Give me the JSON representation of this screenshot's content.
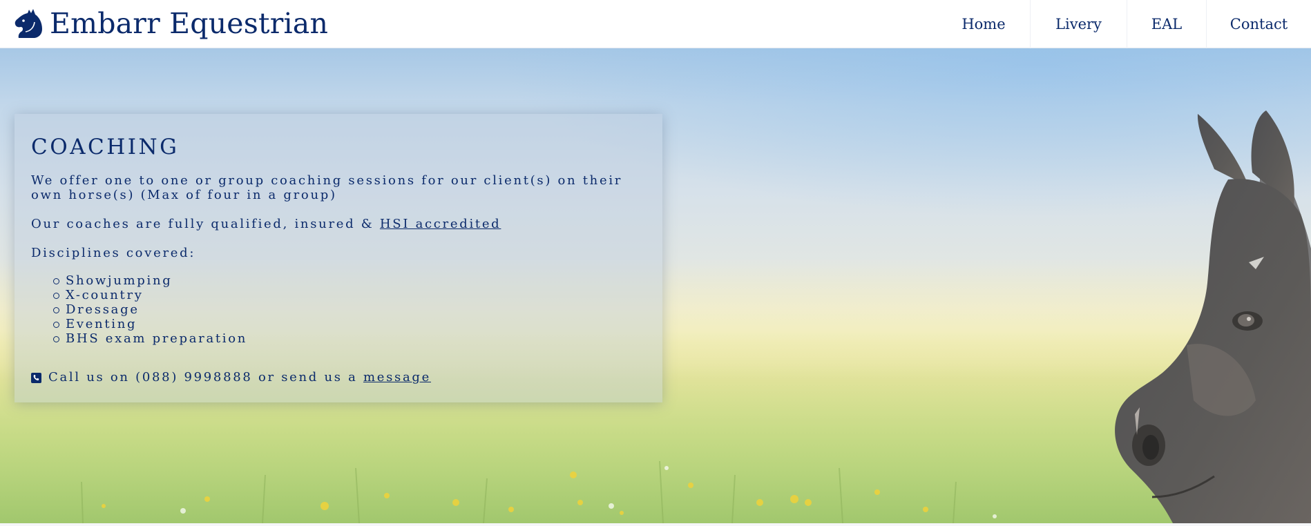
{
  "header": {
    "brand_name": "Embarr Equestrian",
    "logo_icon": "horse-head-icon",
    "nav": [
      {
        "label": "Home"
      },
      {
        "label": "Livery"
      },
      {
        "label": "EAL"
      },
      {
        "label": "Contact"
      }
    ]
  },
  "panel": {
    "title": "COACHING",
    "intro": "We offer one to one or group coaching sessions for our client(s) on their own horse(s) (Max of four in a group)",
    "coaches_prefix": "Our coaches are fully qualified, insured & ",
    "coaches_link": "HSI accredited",
    "disciplines_label": "Disciplines covered:",
    "disciplines": [
      "Showjumping",
      "X-country",
      "Dressage",
      "Eventing",
      "BHS exam preparation"
    ],
    "call_icon": "phone-icon",
    "call_prefix": "Call us on (088) 9998888 or send us a ",
    "call_link": "message"
  },
  "colors": {
    "brand": "#0b2a6b",
    "header_bg": "#ffffff",
    "panel_overlay": "#bed0de"
  }
}
